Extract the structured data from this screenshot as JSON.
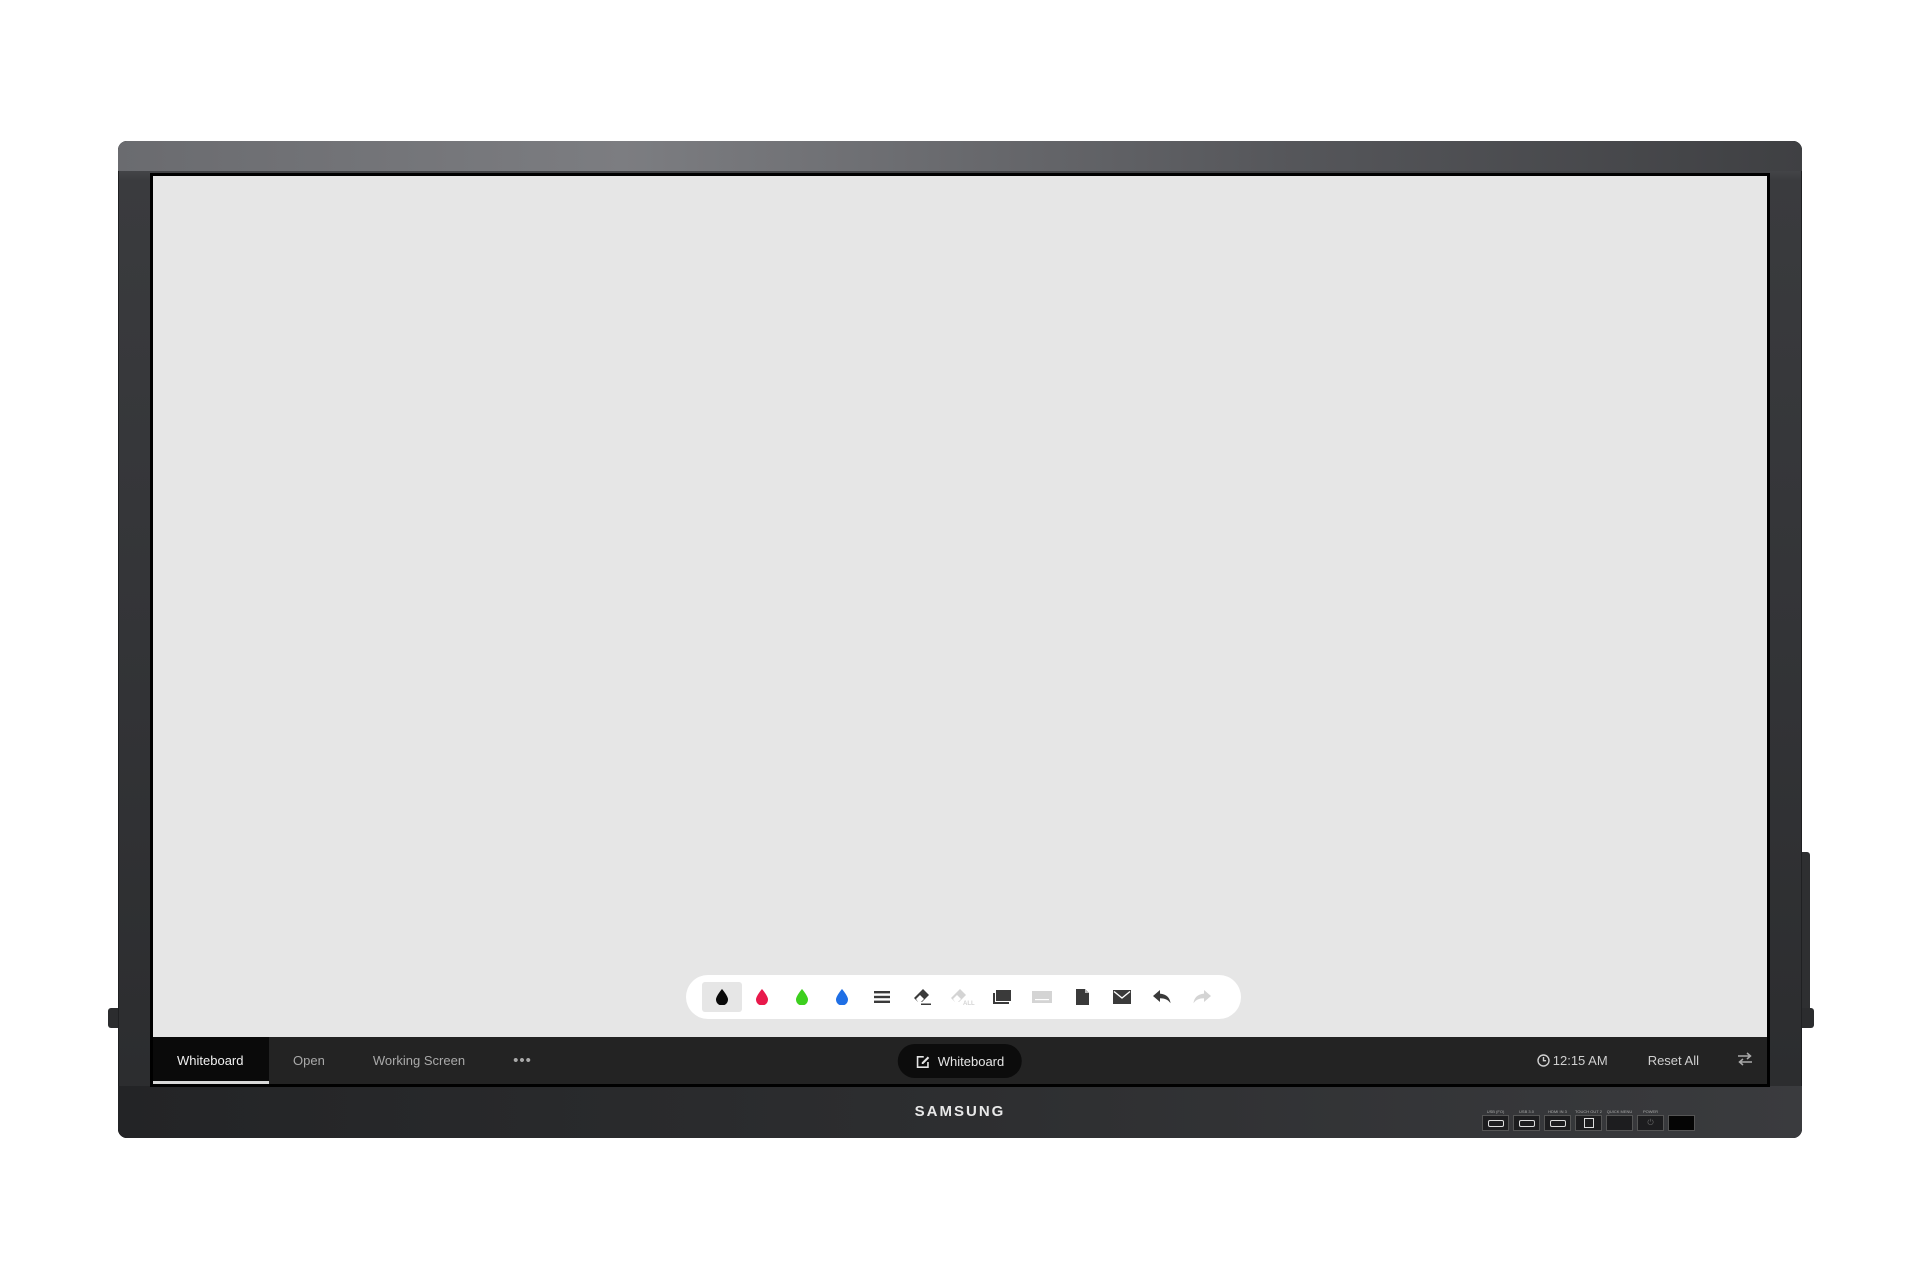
{
  "device": {
    "brand": "SAMSUNG",
    "ports": [
      {
        "label": "USB (FO)",
        "type": "usb"
      },
      {
        "label": "USB 3.0",
        "type": "usb"
      },
      {
        "label": "HDMI IN 3",
        "type": "hdmi"
      },
      {
        "label": "TOUCH OUT 2",
        "type": "usb-b"
      },
      {
        "label": "QUICK MENU",
        "type": "button"
      },
      {
        "label": "POWER",
        "type": "power-button"
      },
      {
        "label": "",
        "type": "sensor"
      }
    ]
  },
  "toolbar": {
    "tools": [
      {
        "name": "pen-black",
        "icon": "drop-icon",
        "color": "#0a0a0a",
        "selected": true,
        "enabled": true
      },
      {
        "name": "pen-red",
        "icon": "drop-icon",
        "color": "#e8194b",
        "enabled": true
      },
      {
        "name": "pen-green",
        "icon": "drop-icon",
        "color": "#3dcf1e",
        "enabled": true
      },
      {
        "name": "pen-blue",
        "icon": "drop-icon",
        "color": "#1f6fe5",
        "enabled": true
      },
      {
        "name": "line-thickness",
        "icon": "menu-lines-icon",
        "enabled": true
      },
      {
        "name": "eraser",
        "icon": "eraser-icon",
        "enabled": true
      },
      {
        "name": "erase-all",
        "icon": "eraser-all-icon",
        "label": "ALL",
        "enabled": false
      },
      {
        "name": "background",
        "icon": "layers-icon",
        "enabled": true
      },
      {
        "name": "keyboard",
        "icon": "keyboard-icon",
        "enabled": false
      },
      {
        "name": "save",
        "icon": "document-icon",
        "enabled": true
      },
      {
        "name": "email",
        "icon": "mail-icon",
        "enabled": true
      },
      {
        "name": "undo",
        "icon": "undo-icon",
        "enabled": true
      },
      {
        "name": "redo",
        "icon": "redo-icon",
        "enabled": false
      }
    ]
  },
  "taskbar": {
    "tabs": [
      {
        "label": "Whiteboard",
        "active": true
      },
      {
        "label": "Open",
        "active": false
      },
      {
        "label": "Working Screen",
        "active": false
      }
    ],
    "more_label": "•••",
    "center_label": "Whiteboard",
    "time": "12:15 AM",
    "reset_label": "Reset All",
    "swap_icon": "swap-arrows-icon"
  },
  "colors": {
    "canvas": "#e6e6e6",
    "taskbar": "#232323",
    "active_tab": "#0a0a0a"
  }
}
